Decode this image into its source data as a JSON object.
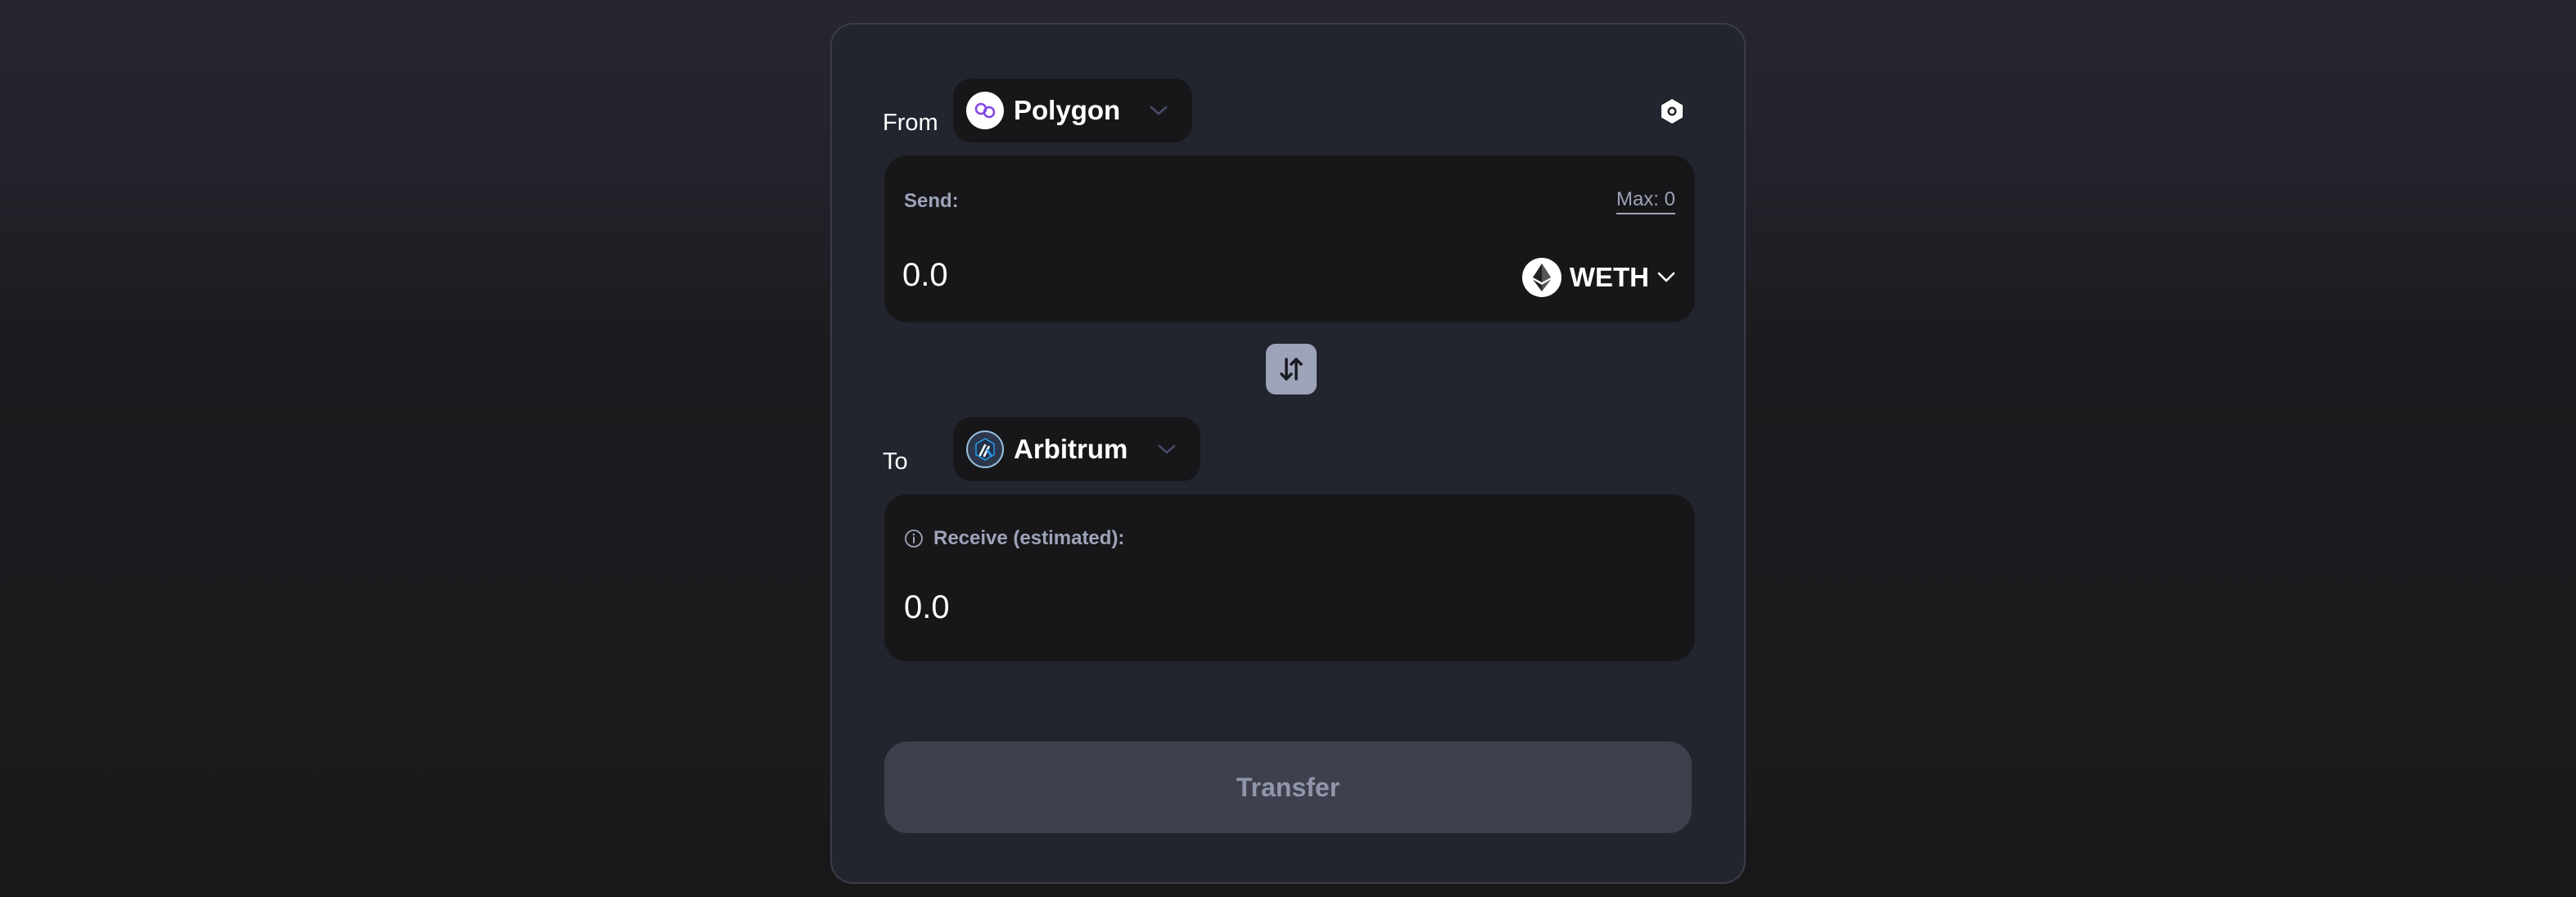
{
  "from": {
    "label": "From",
    "chain": {
      "name": "Polygon",
      "icon": "polygon-logo-icon"
    }
  },
  "settings": {
    "icon": "settings-icon"
  },
  "send": {
    "label": "Send:",
    "max_label": "Max: 0",
    "amount": "0.0",
    "token": {
      "name": "WETH",
      "icon": "ethereum-logo-icon"
    }
  },
  "switch": {
    "icon": "swap-direction-icon"
  },
  "to": {
    "label": "To",
    "chain": {
      "name": "Arbitrum",
      "icon": "arbitrum-logo-icon"
    }
  },
  "receive": {
    "label": "Receive (estimated):",
    "amount": "0.0",
    "info_icon": "info-icon"
  },
  "transfer": {
    "label": "Transfer",
    "disabled": true
  },
  "colors": {
    "panel": "#22242e",
    "field": "#17171a",
    "muted_text": "#9da3b8",
    "button_disabled": "#3e404d",
    "polygon_purple": "#8247e5",
    "arbitrum_blue": "#28a0f0"
  }
}
